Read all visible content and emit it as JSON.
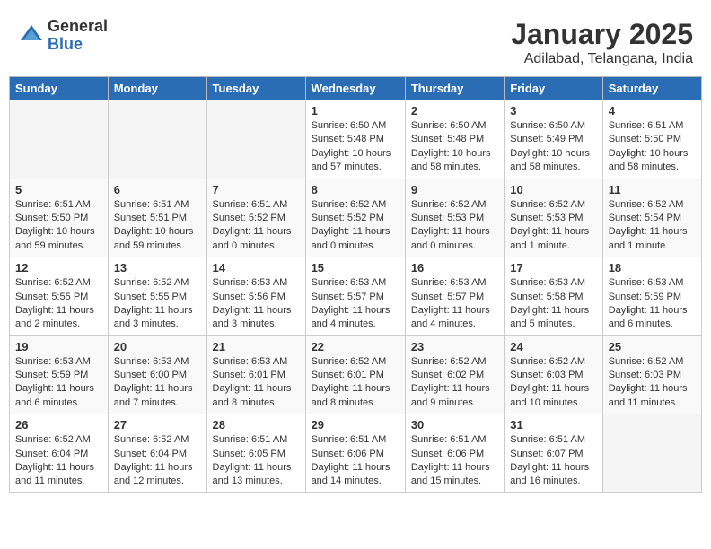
{
  "header": {
    "logo_general": "General",
    "logo_blue": "Blue",
    "month_title": "January 2025",
    "location": "Adilabad, Telangana, India"
  },
  "weekdays": [
    "Sunday",
    "Monday",
    "Tuesday",
    "Wednesday",
    "Thursday",
    "Friday",
    "Saturday"
  ],
  "weeks": [
    [
      {
        "day": "",
        "info": ""
      },
      {
        "day": "",
        "info": ""
      },
      {
        "day": "",
        "info": ""
      },
      {
        "day": "1",
        "info": "Sunrise: 6:50 AM\nSunset: 5:48 PM\nDaylight: 10 hours\nand 57 minutes."
      },
      {
        "day": "2",
        "info": "Sunrise: 6:50 AM\nSunset: 5:48 PM\nDaylight: 10 hours\nand 58 minutes."
      },
      {
        "day": "3",
        "info": "Sunrise: 6:50 AM\nSunset: 5:49 PM\nDaylight: 10 hours\nand 58 minutes."
      },
      {
        "day": "4",
        "info": "Sunrise: 6:51 AM\nSunset: 5:50 PM\nDaylight: 10 hours\nand 58 minutes."
      }
    ],
    [
      {
        "day": "5",
        "info": "Sunrise: 6:51 AM\nSunset: 5:50 PM\nDaylight: 10 hours\nand 59 minutes."
      },
      {
        "day": "6",
        "info": "Sunrise: 6:51 AM\nSunset: 5:51 PM\nDaylight: 10 hours\nand 59 minutes."
      },
      {
        "day": "7",
        "info": "Sunrise: 6:51 AM\nSunset: 5:52 PM\nDaylight: 11 hours\nand 0 minutes."
      },
      {
        "day": "8",
        "info": "Sunrise: 6:52 AM\nSunset: 5:52 PM\nDaylight: 11 hours\nand 0 minutes."
      },
      {
        "day": "9",
        "info": "Sunrise: 6:52 AM\nSunset: 5:53 PM\nDaylight: 11 hours\nand 0 minutes."
      },
      {
        "day": "10",
        "info": "Sunrise: 6:52 AM\nSunset: 5:53 PM\nDaylight: 11 hours\nand 1 minute."
      },
      {
        "day": "11",
        "info": "Sunrise: 6:52 AM\nSunset: 5:54 PM\nDaylight: 11 hours\nand 1 minute."
      }
    ],
    [
      {
        "day": "12",
        "info": "Sunrise: 6:52 AM\nSunset: 5:55 PM\nDaylight: 11 hours\nand 2 minutes."
      },
      {
        "day": "13",
        "info": "Sunrise: 6:52 AM\nSunset: 5:55 PM\nDaylight: 11 hours\nand 3 minutes."
      },
      {
        "day": "14",
        "info": "Sunrise: 6:53 AM\nSunset: 5:56 PM\nDaylight: 11 hours\nand 3 minutes."
      },
      {
        "day": "15",
        "info": "Sunrise: 6:53 AM\nSunset: 5:57 PM\nDaylight: 11 hours\nand 4 minutes."
      },
      {
        "day": "16",
        "info": "Sunrise: 6:53 AM\nSunset: 5:57 PM\nDaylight: 11 hours\nand 4 minutes."
      },
      {
        "day": "17",
        "info": "Sunrise: 6:53 AM\nSunset: 5:58 PM\nDaylight: 11 hours\nand 5 minutes."
      },
      {
        "day": "18",
        "info": "Sunrise: 6:53 AM\nSunset: 5:59 PM\nDaylight: 11 hours\nand 6 minutes."
      }
    ],
    [
      {
        "day": "19",
        "info": "Sunrise: 6:53 AM\nSunset: 5:59 PM\nDaylight: 11 hours\nand 6 minutes."
      },
      {
        "day": "20",
        "info": "Sunrise: 6:53 AM\nSunset: 6:00 PM\nDaylight: 11 hours\nand 7 minutes."
      },
      {
        "day": "21",
        "info": "Sunrise: 6:53 AM\nSunset: 6:01 PM\nDaylight: 11 hours\nand 8 minutes."
      },
      {
        "day": "22",
        "info": "Sunrise: 6:52 AM\nSunset: 6:01 PM\nDaylight: 11 hours\nand 8 minutes."
      },
      {
        "day": "23",
        "info": "Sunrise: 6:52 AM\nSunset: 6:02 PM\nDaylight: 11 hours\nand 9 minutes."
      },
      {
        "day": "24",
        "info": "Sunrise: 6:52 AM\nSunset: 6:03 PM\nDaylight: 11 hours\nand 10 minutes."
      },
      {
        "day": "25",
        "info": "Sunrise: 6:52 AM\nSunset: 6:03 PM\nDaylight: 11 hours\nand 11 minutes."
      }
    ],
    [
      {
        "day": "26",
        "info": "Sunrise: 6:52 AM\nSunset: 6:04 PM\nDaylight: 11 hours\nand 11 minutes."
      },
      {
        "day": "27",
        "info": "Sunrise: 6:52 AM\nSunset: 6:04 PM\nDaylight: 11 hours\nand 12 minutes."
      },
      {
        "day": "28",
        "info": "Sunrise: 6:51 AM\nSunset: 6:05 PM\nDaylight: 11 hours\nand 13 minutes."
      },
      {
        "day": "29",
        "info": "Sunrise: 6:51 AM\nSunset: 6:06 PM\nDaylight: 11 hours\nand 14 minutes."
      },
      {
        "day": "30",
        "info": "Sunrise: 6:51 AM\nSunset: 6:06 PM\nDaylight: 11 hours\nand 15 minutes."
      },
      {
        "day": "31",
        "info": "Sunrise: 6:51 AM\nSunset: 6:07 PM\nDaylight: 11 hours\nand 16 minutes."
      },
      {
        "day": "",
        "info": ""
      }
    ]
  ]
}
